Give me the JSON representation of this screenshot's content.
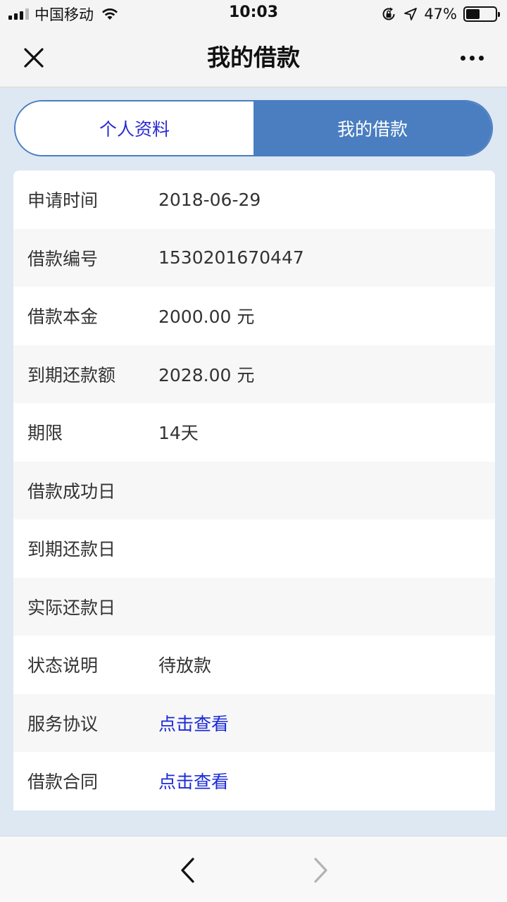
{
  "status_bar": {
    "carrier": "中国移动",
    "time": "10:03",
    "battery": "47%",
    "battery_level": 0.47,
    "icons": [
      "signal-icon",
      "wifi-icon",
      "rotation-lock-icon",
      "location-arrow-icon",
      "battery-icon"
    ]
  },
  "nav": {
    "title": "我的借款",
    "close_icon": "close-icon",
    "more_icon": "more-icon"
  },
  "tabs": [
    {
      "label": "个人资料",
      "active": false
    },
    {
      "label": "我的借款",
      "active": true
    }
  ],
  "loan": {
    "rows": [
      {
        "label": "申请时间",
        "value": "2018-06-29"
      },
      {
        "label": "借款编号",
        "value": "1530201670447"
      },
      {
        "label": "借款本金",
        "value": "2000.00 元"
      },
      {
        "label": "到期还款额",
        "value": "2028.00 元"
      },
      {
        "label": "期限",
        "value": "14天"
      },
      {
        "label": "借款成功日",
        "value": ""
      },
      {
        "label": "到期还款日",
        "value": ""
      },
      {
        "label": "实际还款日",
        "value": ""
      },
      {
        "label": "状态说明",
        "value": "待放款"
      },
      {
        "label": "服务协议",
        "value": "点击查看"
      },
      {
        "label": "借款合同",
        "value": "点击查看"
      }
    ]
  },
  "colors": {
    "accent": "#4a7ec0",
    "link": "#1a2ad8",
    "page_bg": "#dde8f3"
  },
  "bottom": {
    "back_icon": "chevron-left-icon",
    "forward_icon": "chevron-right-icon"
  }
}
